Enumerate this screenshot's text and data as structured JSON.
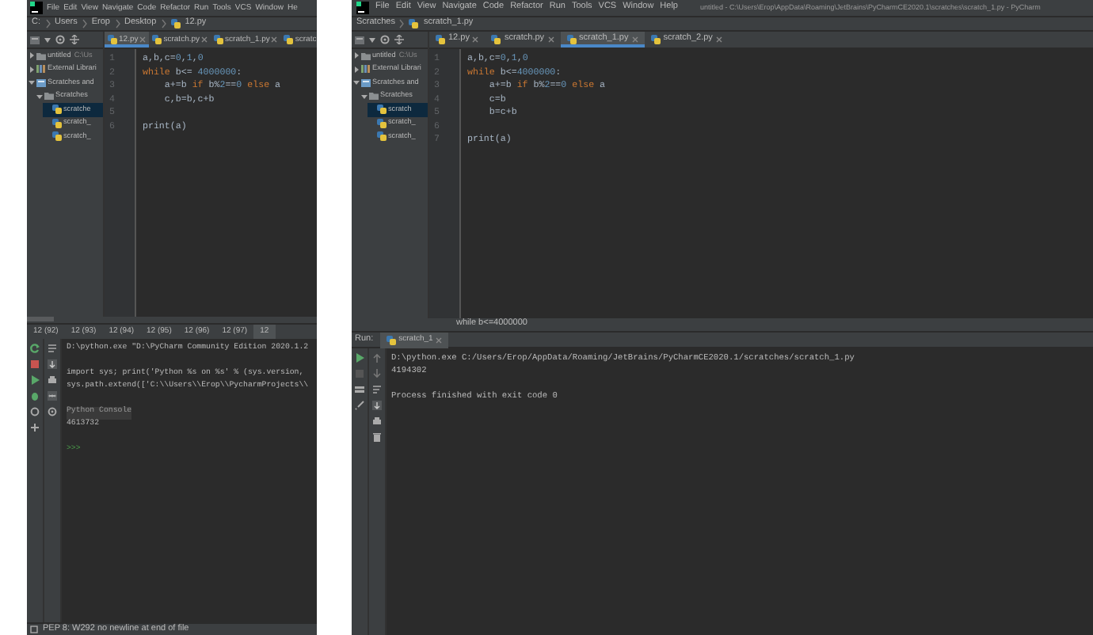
{
  "left_window": {
    "menu": [
      "File",
      "Edit",
      "View",
      "Navigate",
      "Code",
      "Refactor",
      "Run",
      "Tools",
      "VCS",
      "Window",
      "He"
    ],
    "breadcrumb": [
      "C:",
      "Users",
      "Erop",
      "Desktop",
      "12.py"
    ],
    "tabs": [
      {
        "label": "12.py",
        "selected": true
      },
      {
        "label": "scratch.py",
        "selected": false
      },
      {
        "label": "scratch_1.py",
        "selected": false
      },
      {
        "label": "scratc",
        "selected": false
      }
    ],
    "project_tree": [
      {
        "label": "untitled",
        "note": "C:\\Us",
        "kind": "project",
        "expanded": false,
        "selected": false
      },
      {
        "label": "External Librari",
        "kind": "library",
        "expanded": false,
        "selected": false
      },
      {
        "label": "Scratches and",
        "kind": "scratches",
        "expanded": true,
        "selected": false,
        "children": [
          {
            "label": "Scratches",
            "kind": "folder",
            "expanded": true,
            "selected": false,
            "children": [
              {
                "label": "scratche",
                "kind": "file",
                "selected": true
              },
              {
                "label": "scratch_",
                "kind": "file",
                "selected": false
              },
              {
                "label": "scratch_",
                "kind": "file",
                "selected": false
              }
            ]
          }
        ]
      }
    ],
    "code": [
      {
        "number": "1",
        "tokens": [
          {
            "text": "a,b,c=",
            "kind": "plain"
          },
          {
            "text": "0",
            "kind": "number"
          },
          {
            "text": ",",
            "kind": "plain"
          },
          {
            "text": "1",
            "kind": "number"
          },
          {
            "text": ",",
            "kind": "plain"
          },
          {
            "text": "0",
            "kind": "number"
          }
        ]
      },
      {
        "number": "2",
        "tokens": [
          {
            "text": "while ",
            "kind": "keyword"
          },
          {
            "text": "b<= ",
            "kind": "plain"
          },
          {
            "text": "4000000",
            "kind": "number"
          },
          {
            "text": ":",
            "kind": "plain"
          }
        ]
      },
      {
        "number": "3",
        "tokens": [
          {
            "text": "    a+=b ",
            "kind": "plain"
          },
          {
            "text": "if ",
            "kind": "keyword"
          },
          {
            "text": "b%",
            "kind": "plain"
          },
          {
            "text": "2",
            "kind": "number"
          },
          {
            "text": "==",
            "kind": "plain"
          },
          {
            "text": "0 ",
            "kind": "number"
          },
          {
            "text": "else ",
            "kind": "keyword"
          },
          {
            "text": "a",
            "kind": "plain"
          }
        ]
      },
      {
        "number": "4",
        "tokens": [
          {
            "text": "    c,b=b,c+b",
            "kind": "plain"
          }
        ]
      },
      {
        "number": "5"
      },
      {
        "number": "6",
        "tokens": [
          {
            "text": "print(a)",
            "kind": "plain"
          }
        ]
      }
    ],
    "console_tabs": [
      {
        "label": "12 (92)",
        "selected": false
      },
      {
        "label": "12 (93)",
        "selected": false
      },
      {
        "label": "12 (94)",
        "selected": false
      },
      {
        "label": "12 (95)",
        "selected": false
      },
      {
        "label": "12 (96)",
        "selected": false
      },
      {
        "label": "12 (97)",
        "selected": false
      },
      {
        "label": "12",
        "selected": true
      }
    ],
    "console": [
      {
        "text": "D:\\python.exe \"D:\\PyCharm Community Edition 2020.1.2",
        "kind": "text"
      },
      {
        "kind": "blank"
      },
      {
        "text": "import sys; print('Python %s on %s' % (sys.version,",
        "kind": "text"
      },
      {
        "text": "sys.path.extend(['C:\\\\Users\\\\Erop\\\\PycharmProjects\\\\",
        "kind": "text"
      },
      {
        "kind": "blank"
      },
      {
        "text": "Python Console",
        "kind": "info"
      },
      {
        "text": "4613732",
        "kind": "text"
      },
      {
        "kind": "blank"
      },
      {
        "text": ">>>",
        "kind": "prompt"
      }
    ],
    "status": "PEP 8: W292 no newline at end of file"
  },
  "right_window": {
    "menu": [
      "File",
      "Edit",
      "View",
      "Navigate",
      "Code",
      "Refactor",
      "Run",
      "Tools",
      "VCS",
      "Window",
      "Help"
    ],
    "title": "untitled - C:\\Users\\Erop\\AppData\\Roaming\\JetBrains\\PyCharmCE2020.1\\scratches\\scratch_1.py - PyCharm",
    "breadcrumb": [
      "Scratches",
      "scratch_1.py"
    ],
    "tabs": [
      {
        "label": "12.py",
        "selected": false
      },
      {
        "label": "scratch.py",
        "selected": false
      },
      {
        "label": "scratch_1.py",
        "selected": true
      },
      {
        "label": "scratch_2.py",
        "selected": false
      }
    ],
    "project_tree": [
      {
        "label": "untitled",
        "note": "C:\\Us",
        "kind": "project",
        "expanded": false,
        "selected": false
      },
      {
        "label": "External Librari",
        "kind": "library",
        "expanded": false,
        "selected": false
      },
      {
        "label": "Scratches and",
        "kind": "scratches",
        "expanded": true,
        "selected": false,
        "children": [
          {
            "label": "Scratches",
            "kind": "folder",
            "expanded": true,
            "selected": false,
            "children": [
              {
                "label": "scratch",
                "kind": "file",
                "selected": true
              },
              {
                "label": "scratch_",
                "kind": "file",
                "selected": false
              },
              {
                "label": "scratch_",
                "kind": "file",
                "selected": false
              }
            ]
          }
        ]
      }
    ],
    "code": [
      {
        "number": "1",
        "tokens": [
          {
            "text": "a,b,c=",
            "kind": "plain"
          },
          {
            "text": "0",
            "kind": "number"
          },
          {
            "text": ",",
            "kind": "plain"
          },
          {
            "text": "1",
            "kind": "number"
          },
          {
            "text": ",",
            "kind": "plain"
          },
          {
            "text": "0",
            "kind": "number"
          }
        ]
      },
      {
        "number": "2",
        "tokens": [
          {
            "text": "while ",
            "kind": "keyword"
          },
          {
            "text": "b<=",
            "kind": "plain"
          },
          {
            "text": "4000000",
            "kind": "number"
          },
          {
            "text": ":",
            "kind": "plain"
          }
        ]
      },
      {
        "number": "3",
        "tokens": [
          {
            "text": "    a+=b ",
            "kind": "plain"
          },
          {
            "text": "if ",
            "kind": "keyword"
          },
          {
            "text": "b%",
            "kind": "plain"
          },
          {
            "text": "2",
            "kind": "number"
          },
          {
            "text": "==",
            "kind": "plain"
          },
          {
            "text": "0 ",
            "kind": "number"
          },
          {
            "text": "else ",
            "kind": "keyword"
          },
          {
            "text": "a",
            "kind": "plain"
          }
        ]
      },
      {
        "number": "4",
        "tokens": [
          {
            "text": "    c=b",
            "kind": "plain"
          }
        ]
      },
      {
        "number": "5",
        "tokens": [
          {
            "text": "    b=c+b",
            "kind": "plain"
          }
        ]
      },
      {
        "number": "6"
      },
      {
        "number": "7",
        "tokens": [
          {
            "text": "print(a)",
            "kind": "plain"
          }
        ]
      }
    ],
    "code_breadcrumb": "while b<=4000000",
    "run_label": "Run:",
    "run_tab": "scratch_1",
    "console": [
      {
        "text": "D:\\python.exe C:/Users/Erop/AppData/Roaming/JetBrains/PyCharmCE2020.1/scratches/scratch_1.py",
        "kind": "text"
      },
      {
        "text": "4194302",
        "kind": "text"
      },
      {
        "kind": "blank"
      },
      {
        "text": "Process finished with exit code 0",
        "kind": "text"
      }
    ]
  }
}
